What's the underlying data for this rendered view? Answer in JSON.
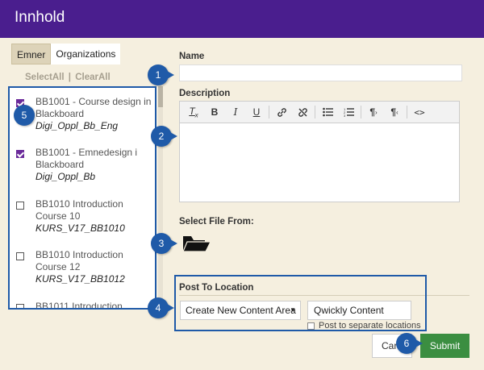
{
  "header": {
    "title": "Innhold"
  },
  "tabs": [
    {
      "label": "Emner"
    },
    {
      "label": "Organizations"
    }
  ],
  "select_links": {
    "select_all": "SelectAll",
    "separator": "|",
    "clear_all": "ClearAll"
  },
  "course_list": [
    {
      "title": "BB1001 - Course design in Blackboard",
      "code": "Digi_Oppl_Bb_Eng",
      "checked": true
    },
    {
      "title": "BB1001 - Emnedesign i Blackboard",
      "code": "Digi_Oppl_Bb",
      "checked": true
    },
    {
      "title": "BB1010 Introduction Course 10",
      "code": "KURS_V17_BB1010",
      "checked": false
    },
    {
      "title": "BB1010 Introduction Course 12",
      "code": "KURS_V17_BB1012",
      "checked": false
    },
    {
      "title": "BB1011 Introduction Course",
      "code": "",
      "checked": false
    }
  ],
  "form": {
    "name_label": "Name",
    "description_label": "Description",
    "select_file_label": "Select File From:",
    "post_to_location_label": "Post To Location",
    "location_select_value": "Create New Content Area",
    "content_name_value": "Qwickly Content",
    "post_separate_label": "Post to separate locations"
  },
  "toolbar": {
    "buttons": [
      "Tx",
      "B",
      "I",
      "U",
      "link",
      "unlink",
      "bullets",
      "numbers",
      "ltr",
      "rtl",
      "code"
    ]
  },
  "buttons": {
    "cancel": "Car",
    "submit": "Submit"
  },
  "badges": [
    "1",
    "2",
    "3",
    "4",
    "5",
    "6"
  ],
  "colors": {
    "header": "#4a1e8e",
    "accent_blue": "#1f5aa8",
    "submit_green": "#3b8e41",
    "background": "#f5efdf"
  }
}
